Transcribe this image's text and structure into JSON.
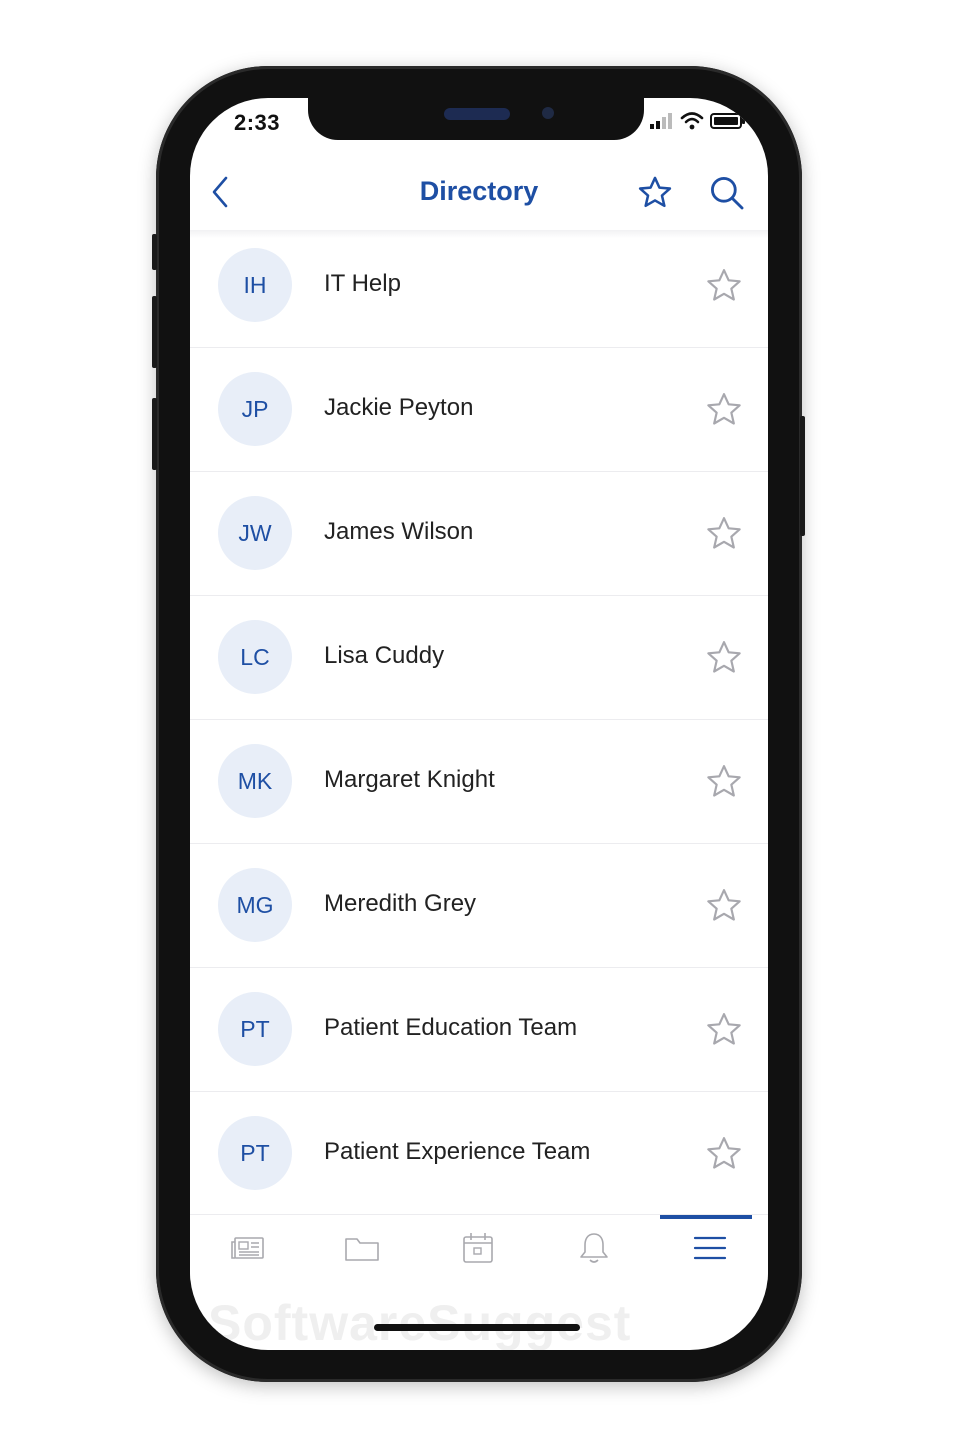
{
  "status_bar": {
    "time": "2:33"
  },
  "header": {
    "title": "Directory",
    "back_icon": "chevron-left-icon",
    "favorite_icon": "star-outline-icon",
    "search_icon": "search-icon"
  },
  "colors": {
    "accent": "#1e4fa4",
    "avatar_bg": "#e8eef8",
    "star_stroke": "#a8a8ae"
  },
  "contacts": [
    {
      "initials": "IH",
      "name": "IT Help"
    },
    {
      "initials": "JP",
      "name": "Jackie Peyton"
    },
    {
      "initials": "JW",
      "name": "James Wilson"
    },
    {
      "initials": "LC",
      "name": "Lisa Cuddy"
    },
    {
      "initials": "MK",
      "name": "Margaret Knight"
    },
    {
      "initials": "MG",
      "name": "Meredith Grey"
    },
    {
      "initials": "PT",
      "name": "Patient Education Team"
    },
    {
      "initials": "PT",
      "name": "Patient Experience Team"
    }
  ],
  "tab_bar": {
    "tabs": [
      {
        "icon": "news-icon"
      },
      {
        "icon": "folder-icon"
      },
      {
        "icon": "calendar-icon"
      },
      {
        "icon": "bell-icon"
      },
      {
        "icon": "menu-icon",
        "active": true
      }
    ]
  },
  "watermark": "SoftwareSuggest"
}
